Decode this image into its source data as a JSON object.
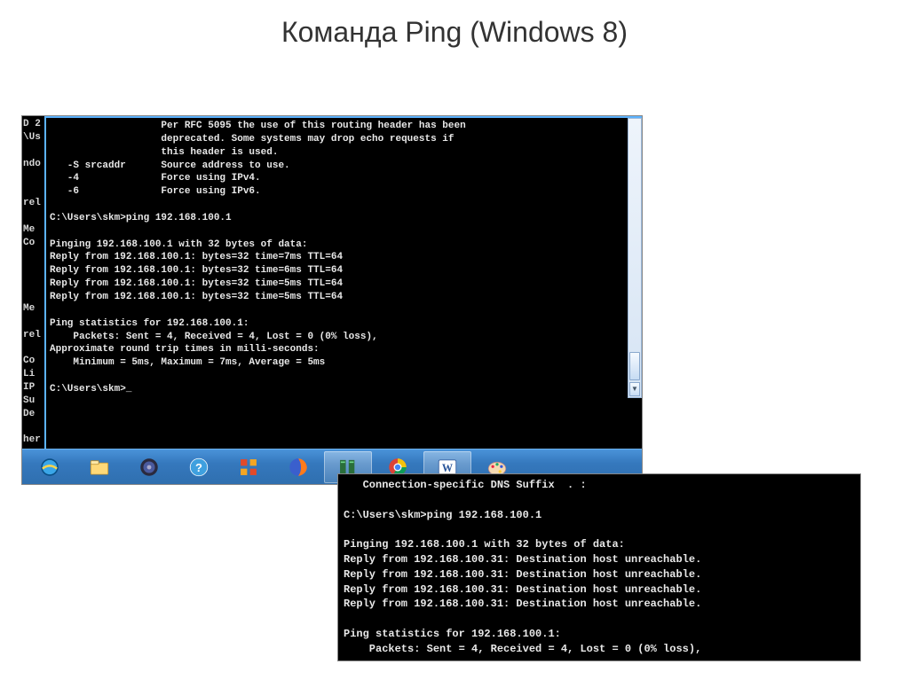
{
  "title": "Команда Ping (Windows 8)",
  "side_strip": "D 2\n\\Us\n\nndo\n\n\nrel\n\nMe\nCo\n\n\n\n\nMe\n\nrel\n\nCo\nLi\nIP\nSu\nDe\n\nher",
  "terminal1_lines": [
    "                   Per RFC 5095 the use of this routing header has been",
    "                   deprecated. Some systems may drop echo requests if",
    "                   this header is used.",
    "   -S srcaddr      Source address to use.",
    "   -4              Force using IPv4.",
    "   -6              Force using IPv6.",
    "",
    "C:\\Users\\skm>ping 192.168.100.1",
    "",
    "Pinging 192.168.100.1 with 32 bytes of data:",
    "Reply from 192.168.100.1: bytes=32 time=7ms TTL=64",
    "Reply from 192.168.100.1: bytes=32 time=6ms TTL=64",
    "Reply from 192.168.100.1: bytes=32 time=5ms TTL=64",
    "Reply from 192.168.100.1: bytes=32 time=5ms TTL=64",
    "",
    "Ping statistics for 192.168.100.1:",
    "    Packets: Sent = 4, Received = 4, Lost = 0 (0% loss),",
    "Approximate round trip times in milli-seconds:",
    "    Minimum = 5ms, Maximum = 7ms, Average = 5ms",
    "",
    "C:\\Users\\skm>_"
  ],
  "terminal2_lines": [
    "   Connection-specific DNS Suffix  . :",
    "",
    "C:\\Users\\skm>ping 192.168.100.1",
    "",
    "Pinging 192.168.100.1 with 32 bytes of data:",
    "Reply from 192.168.100.31: Destination host unreachable.",
    "Reply from 192.168.100.31: Destination host unreachable.",
    "Reply from 192.168.100.31: Destination host unreachable.",
    "Reply from 192.168.100.31: Destination host unreachable.",
    "",
    "Ping statistics for 192.168.100.1:",
    "    Packets: Sent = 4, Received = 4, Lost = 0 (0% loss),"
  ],
  "taskbar": [
    {
      "name": "internet-explorer-icon"
    },
    {
      "name": "file-explorer-icon"
    },
    {
      "name": "media-app-icon"
    },
    {
      "name": "help-icon"
    },
    {
      "name": "office-icon"
    },
    {
      "name": "firefox-icon"
    },
    {
      "name": "server-monitor-icon"
    },
    {
      "name": "chrome-icon"
    },
    {
      "name": "word-icon"
    },
    {
      "name": "paint-icon"
    }
  ]
}
